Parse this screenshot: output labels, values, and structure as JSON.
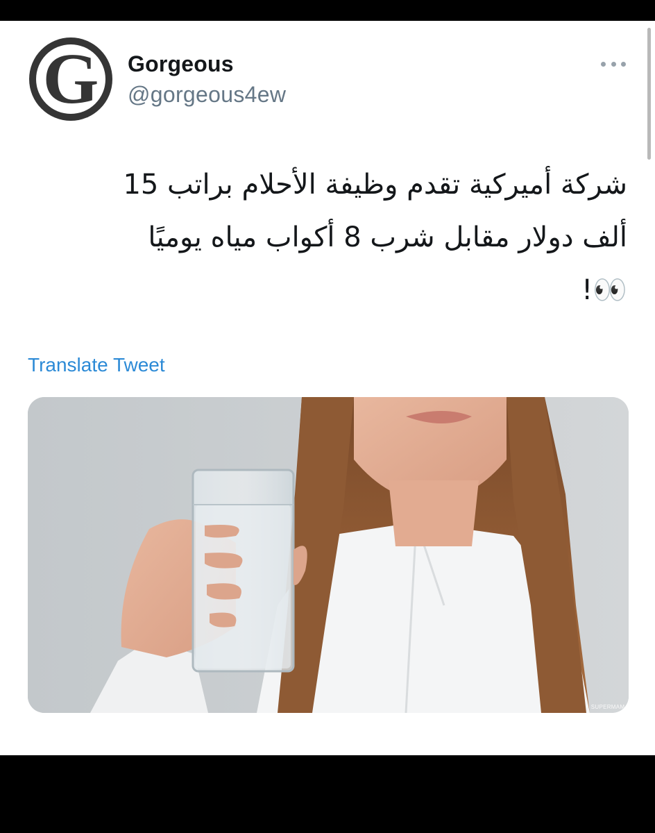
{
  "tweet": {
    "author": {
      "avatar_letter": "G",
      "display_name": "Gorgeous",
      "handle": "@gorgeous4ew"
    },
    "more_icon": "ellipsis-icon",
    "text_lines": [
      "شركة أميركية تقدم وظيفة الأحلام براتب 15",
      "ألف دولار مقابل شرب 8 أكواب مياه يوميًا",
      "👀!"
    ],
    "translate_label": "Translate Tweet",
    "media": {
      "watermark": "SUPERMAMA"
    }
  },
  "colors": {
    "link": "#2c8ad6",
    "handle": "#657786",
    "text": "#14171a",
    "avatar_ring": "#333333"
  }
}
